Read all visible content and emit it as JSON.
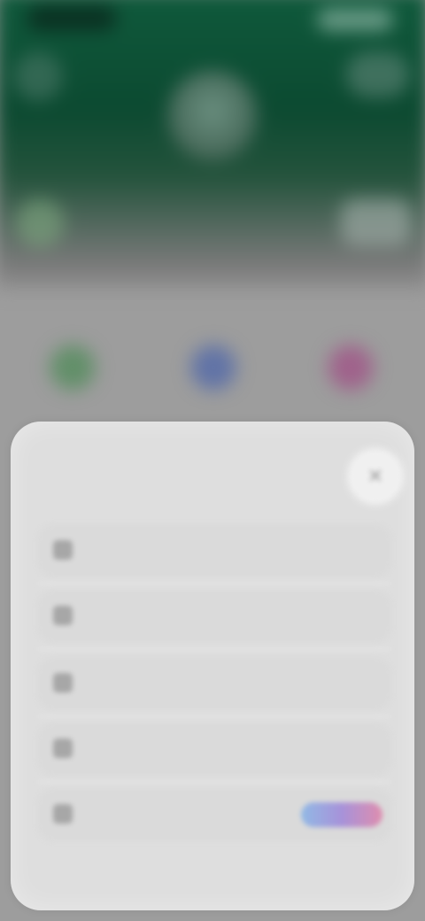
{
  "sheet": {
    "title": "",
    "close_icon": "close-icon",
    "options": [
      {
        "label": "",
        "icon": "option-icon"
      },
      {
        "label": "",
        "icon": "option-icon"
      },
      {
        "label": "",
        "icon": "option-icon"
      },
      {
        "label": "",
        "icon": "option-icon"
      },
      {
        "label": "",
        "icon": "option-icon",
        "badge": ""
      }
    ]
  },
  "background": {
    "section_label": "",
    "action_colors": [
      "#4f8b58",
      "#4e66aa",
      "#a04f85"
    ]
  }
}
